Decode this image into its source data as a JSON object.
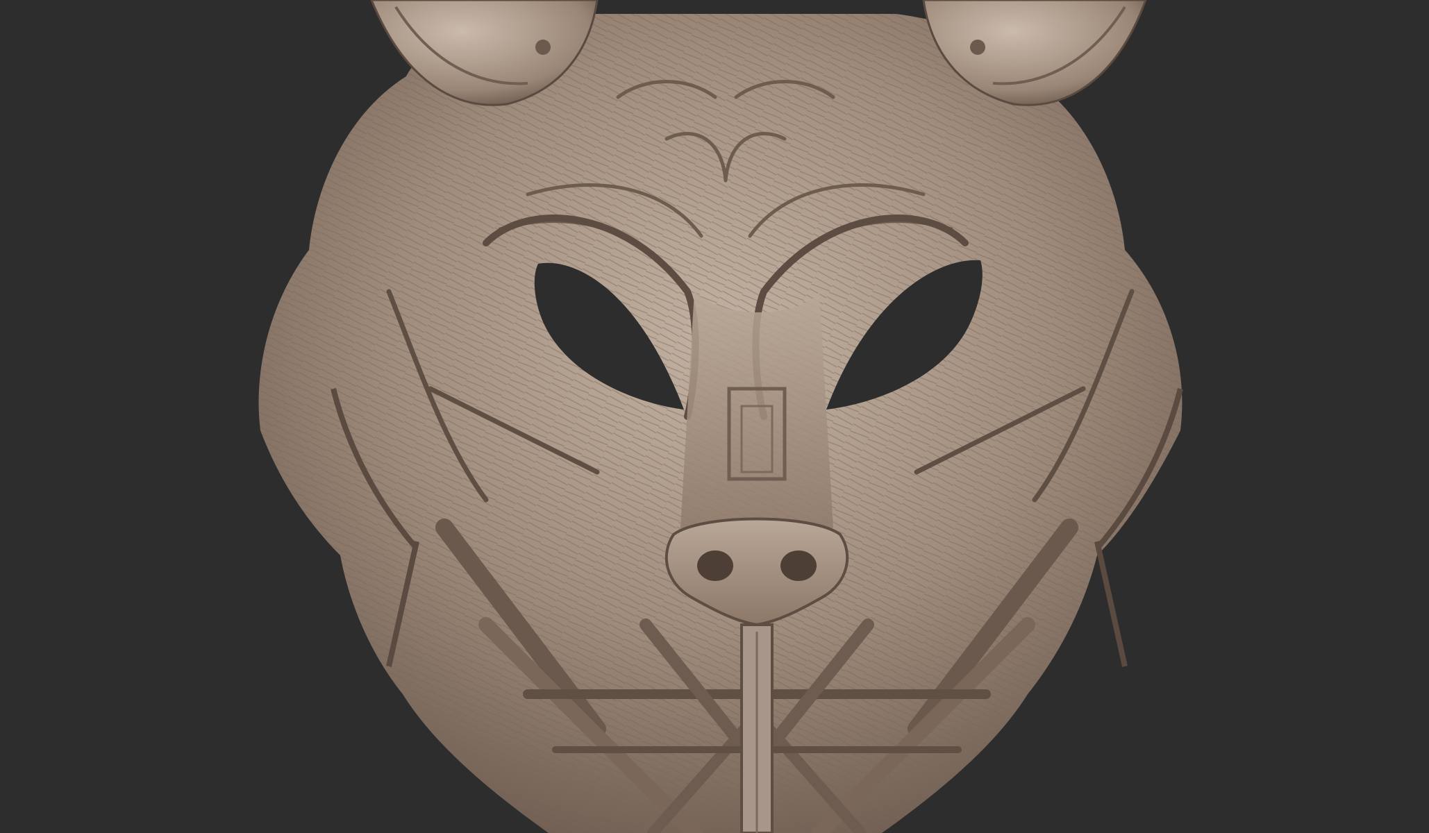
{
  "scene": {
    "subject": "mask-sculpt",
    "colors": {
      "background": "#2d2d2d",
      "clay_light": "#bba99a",
      "clay_mid": "#9c8878",
      "clay_dark": "#6b5a4d",
      "shadow": "#3e342e"
    }
  }
}
